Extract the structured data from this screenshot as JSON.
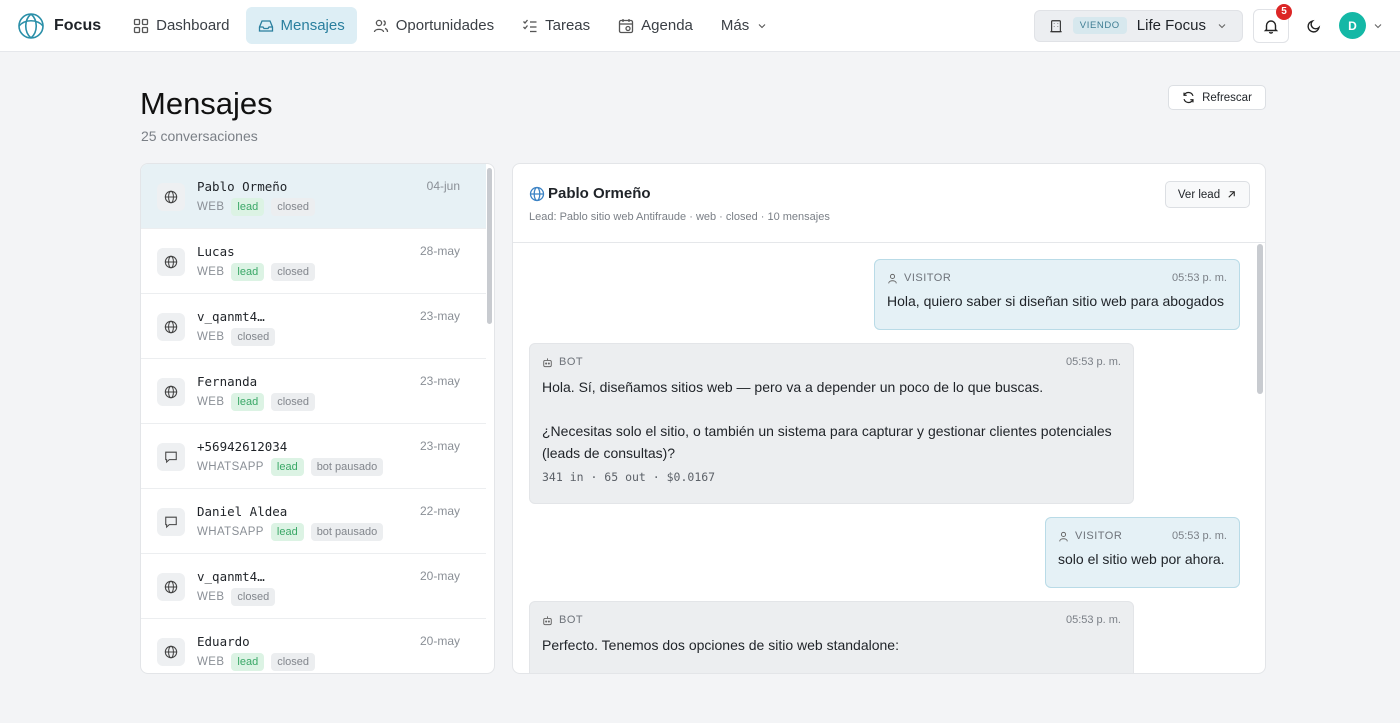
{
  "brand": {
    "name": "Focus"
  },
  "nav": {
    "items": [
      {
        "label": "Dashboard",
        "icon": "dashboard-icon",
        "active": false
      },
      {
        "label": "Mensajes",
        "icon": "inbox-icon",
        "active": true
      },
      {
        "label": "Oportunidades",
        "icon": "users-icon",
        "active": false
      },
      {
        "label": "Tareas",
        "icon": "checklist-icon",
        "active": false
      },
      {
        "label": "Agenda",
        "icon": "calendar-icon",
        "active": false
      },
      {
        "label": "Más",
        "icon": "chevron-down-icon",
        "active": false
      }
    ]
  },
  "workspace": {
    "viewing_label": "VIENDO",
    "name": "Life Focus"
  },
  "notifications": {
    "count": "5"
  },
  "user": {
    "initial": "D"
  },
  "page": {
    "title": "Mensajes",
    "subtitle": "25 conversaciones",
    "refresh_label": "Refrescar"
  },
  "conversations": [
    {
      "name": "Pablo Ormeño",
      "date": "04-jun",
      "channel": "WEB",
      "tags": [
        "lead",
        "closed"
      ],
      "icon": "globe-icon"
    },
    {
      "name": "Lucas",
      "date": "28-may",
      "channel": "WEB",
      "tags": [
        "lead",
        "closed"
      ],
      "icon": "globe-icon"
    },
    {
      "name": "v_qanmt4…",
      "date": "23-may",
      "channel": "WEB",
      "tags": [
        "closed"
      ],
      "icon": "globe-icon"
    },
    {
      "name": "Fernanda",
      "date": "23-may",
      "channel": "WEB",
      "tags": [
        "lead",
        "closed"
      ],
      "icon": "globe-icon"
    },
    {
      "name": "+56942612034",
      "date": "23-may",
      "channel": "WHATSAPP",
      "tags": [
        "lead",
        "bot pausado"
      ],
      "icon": "chat-icon"
    },
    {
      "name": "Daniel Aldea",
      "date": "22-may",
      "channel": "WHATSAPP",
      "tags": [
        "lead",
        "bot pausado"
      ],
      "icon": "chat-icon"
    },
    {
      "name": "v_qanmt4…",
      "date": "20-may",
      "channel": "WEB",
      "tags": [
        "closed"
      ],
      "icon": "globe-icon"
    },
    {
      "name": "Eduardo",
      "date": "20-may",
      "channel": "WEB",
      "tags": [
        "lead",
        "closed"
      ],
      "icon": "globe-icon"
    }
  ],
  "chat": {
    "title": "Pablo Ormeño",
    "subtitle": "Lead: Pablo sitio web Antifraude · web · closed · 10 mensajes",
    "ver_lead_label": "Ver lead",
    "messages": [
      {
        "role": "VISITOR",
        "time": "05:53 p. m.",
        "text": "Hola, quiero saber si diseñan sitio web para abogados",
        "tokens": ""
      },
      {
        "role": "BOT",
        "time": "05:53 p. m.",
        "text": "Hola. Sí, diseñamos sitios web — pero va a depender un poco de lo que buscas.\n\n¿Necesitas solo el sitio, o también un sistema para capturar y gestionar clientes potenciales (leads de consultas)?",
        "tokens": "341 in · 65 out · $0.0167"
      },
      {
        "role": "VISITOR",
        "time": "05:53 p. m.",
        "text": "solo el sitio web por ahora.",
        "tokens": ""
      },
      {
        "role": "BOT",
        "time": "05:53 p. m.",
        "text": "Perfecto. Tenemos dos opciones de sitio web standalone:",
        "tokens": ""
      }
    ]
  }
}
